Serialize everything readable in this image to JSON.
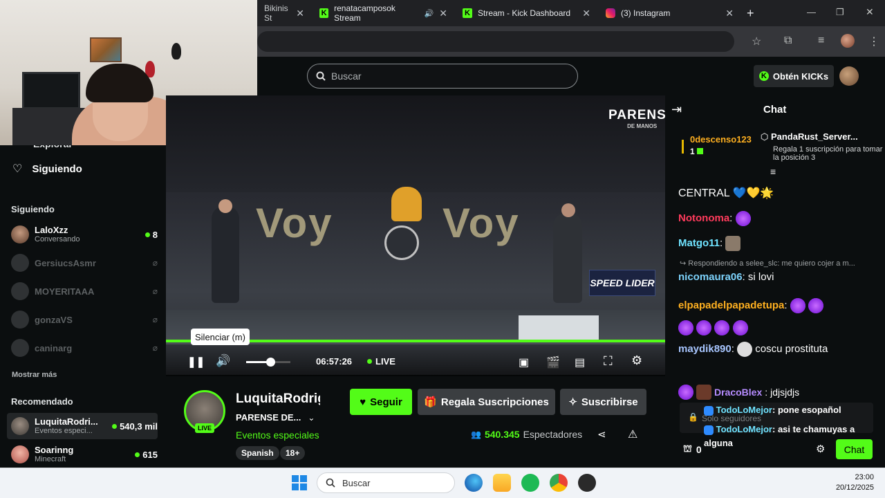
{
  "browser": {
    "tabs": [
      {
        "title": "Bikinis St",
        "favicon": "kick-icon"
      },
      {
        "title": "renatacamposok Stream",
        "favicon": "kick-icon",
        "audio": true
      },
      {
        "title": "Stream - Kick Dashboard",
        "favicon": "kick-icon"
      },
      {
        "title": "(3) Instagram",
        "favicon": "instagram-icon"
      }
    ],
    "new_tab": "+",
    "window_controls": [
      "—",
      "❐",
      "✕"
    ]
  },
  "header": {
    "search_placeholder": "Buscar",
    "get_kicks": "Obtén KICKs"
  },
  "sidebar": {
    "explore_label": "Explorar",
    "following_nav": "Siguiendo",
    "following_heading": "Siguiendo",
    "following": [
      {
        "name": "LaloXzz",
        "sub": "Conversando",
        "count": "8",
        "online": true
      },
      {
        "name": "GersiucsAsmr",
        "online": false
      },
      {
        "name": "MOYERITAAA",
        "online": false
      },
      {
        "name": "gonzaVS",
        "online": false
      },
      {
        "name": "caninarg",
        "online": false
      }
    ],
    "show_more": "Mostrar más",
    "recommended_heading": "Recomendado",
    "recommended": [
      {
        "name": "LuquitaRodri...",
        "sub": "Eventos especi...",
        "count": "540,3 mil",
        "active": true
      },
      {
        "name": "Soarinng",
        "sub": "Minecraft",
        "count": "615"
      }
    ]
  },
  "video": {
    "overlay_logo": "PARENSE",
    "overlay_logo_sub": "DE MANOS",
    "banner_left": "Voy",
    "banner_right": "Voy",
    "sponsor": "SPEED LIDER",
    "tooltip": "Silenciar (m)",
    "time": "06:57:26",
    "live_label": "LIVE",
    "volume_level": 0.55
  },
  "stream": {
    "streamer": "LuquitaRodriguez",
    "title": "PARENSE DE...",
    "category": "Eventos especiales",
    "live_badge": "LIVE",
    "tags": [
      "Spanish",
      "18+"
    ],
    "follow_label": "Seguir",
    "gift_label": "Regala Suscripciones",
    "subscribe_label": "Suscribirse",
    "viewers": "540.345",
    "viewers_label": "Espectadores"
  },
  "chat": {
    "title": "Chat",
    "pinned_user": "0descenso123",
    "pinned_count": "1",
    "gift_user": "PandaRust_Server...",
    "gift_text": "Regala 1 suscripción para tomar la posición 3",
    "messages": [
      {
        "user": "",
        "text": "CENTRAL 💙💛🌟",
        "color": "#ffffff"
      },
      {
        "user": "Notonoma",
        "text": "",
        "color": "#ff3b5c"
      },
      {
        "user": "Matgo11",
        "text": "",
        "color": "#6fe3ff"
      },
      {
        "reply": "Respondiendo a selee_slc: me quiero cojer a m..."
      },
      {
        "user": "nicomaura06",
        "text": "si lovi",
        "color": "#7dd3fc"
      },
      {
        "user": "elpapadelpapadetupa",
        "text": "",
        "color": "#ffb020"
      },
      {
        "user": "maydik890",
        "text": "coscu prostituta",
        "color": "#a8c6ff"
      },
      {
        "user": "DracoBlex",
        "text": "jdjsjdjs",
        "color": "#b68cff"
      },
      {
        "user": "TodoLoMejor",
        "text": "pone esopañol",
        "color": "#6fe3ff"
      },
      {
        "user": "TodoLoMejor",
        "text": "asi te chamuyas a alguna",
        "color": "#6fe3ff"
      }
    ],
    "followers_only": "Solo seguidores",
    "points": "0",
    "send_label": "Chat"
  },
  "taskbar": {
    "search_placeholder": "Buscar",
    "time": "23:00",
    "date": "20/12/2025"
  },
  "colors": {
    "kick_green": "#53fc18",
    "background": "#0b0e0f"
  }
}
